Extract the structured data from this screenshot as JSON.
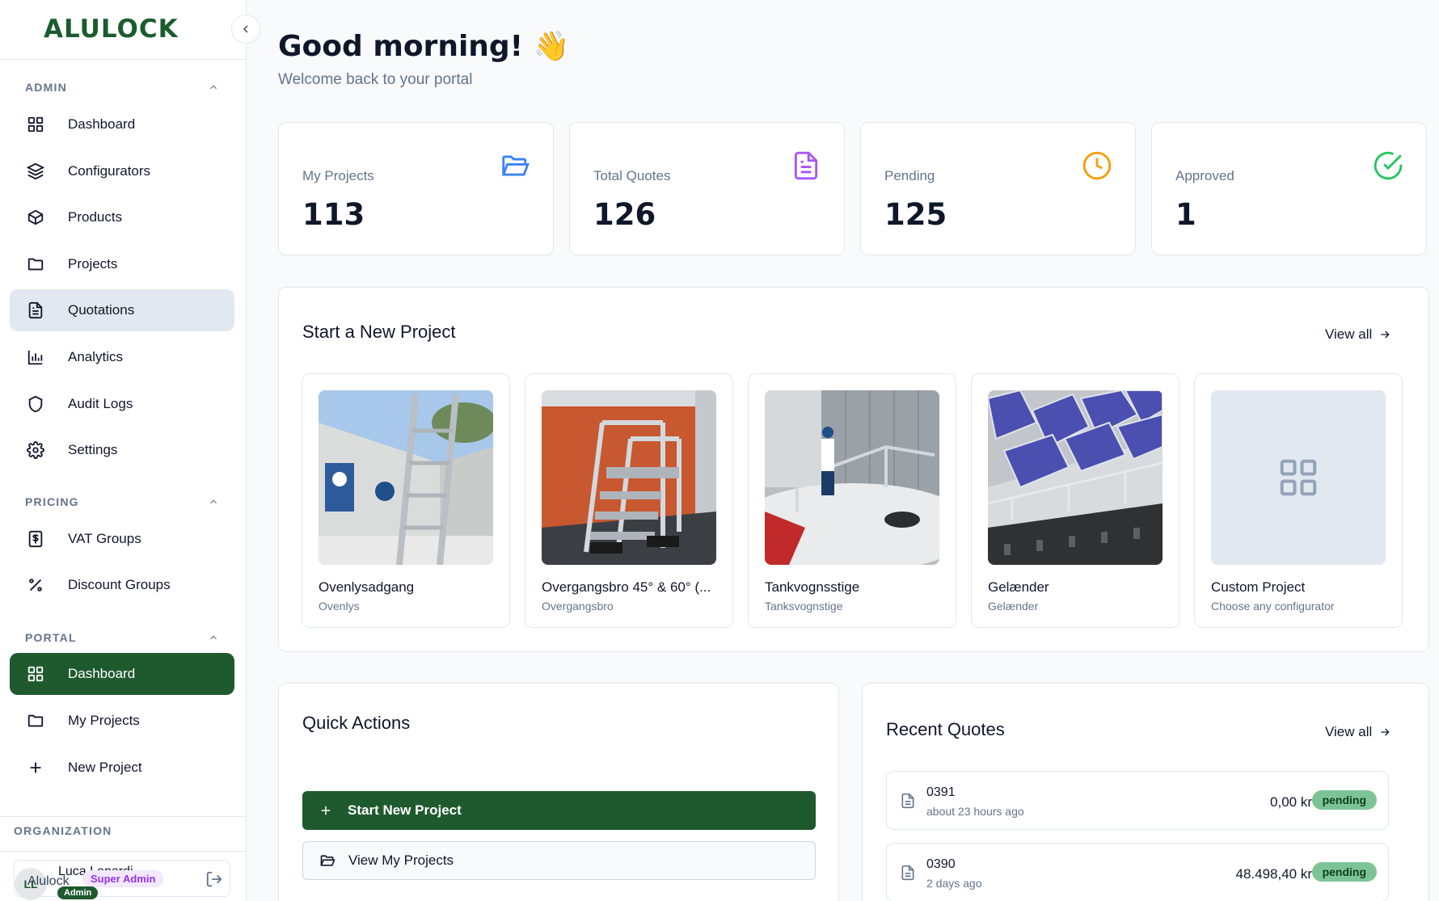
{
  "brand": {
    "logo_text": "ALULOCK"
  },
  "sidebar": {
    "sections": {
      "admin": "ADMIN",
      "pricing": "PRICING",
      "portal": "PORTAL",
      "organization": "ORGANIZATION"
    },
    "admin_items": [
      {
        "label": "Dashboard",
        "icon": "grid-icon"
      },
      {
        "label": "Configurators",
        "icon": "layers-icon"
      },
      {
        "label": "Products",
        "icon": "box-icon"
      },
      {
        "label": "Projects",
        "icon": "folder-icon"
      },
      {
        "label": "Quotations",
        "icon": "file-text-icon"
      },
      {
        "label": "Analytics",
        "icon": "bar-chart-icon"
      },
      {
        "label": "Audit Logs",
        "icon": "shield-icon"
      },
      {
        "label": "Settings",
        "icon": "gear-icon"
      }
    ],
    "pricing_items": [
      {
        "label": "VAT Groups",
        "icon": "dollar-receipt-icon"
      },
      {
        "label": "Discount Groups",
        "icon": "percent-icon"
      }
    ],
    "portal_items": [
      {
        "label": "Dashboard",
        "icon": "grid-icon"
      },
      {
        "label": "My Projects",
        "icon": "folder-icon"
      },
      {
        "label": "New Project",
        "icon": "plus-icon"
      }
    ],
    "user": {
      "avatar_initials": "LL",
      "name": "Luca Lonardi",
      "org": "Alulock",
      "role_badge": "Super Admin",
      "admin_badge": "Admin"
    }
  },
  "header": {
    "greeting": "Good morning! 👋",
    "subtitle": "Welcome back to your portal"
  },
  "stats": [
    {
      "label": "My Projects",
      "value": "113",
      "icon": "folder-open-icon",
      "color": "#3b82f6"
    },
    {
      "label": "Total Quotes",
      "value": "126",
      "icon": "file-text-icon",
      "color": "#a855f7"
    },
    {
      "label": "Pending",
      "value": "125",
      "icon": "clock-icon",
      "color": "#f59e0b"
    },
    {
      "label": "Approved",
      "value": "1",
      "icon": "check-circle-icon",
      "color": "#22c55e"
    }
  ],
  "new_project": {
    "title": "Start a New Project",
    "view_all": "View all",
    "items": [
      {
        "name": "Ovenlysadgang",
        "sub": "Ovenlys"
      },
      {
        "name": "Overgangsbro 45° & 60° (...",
        "sub": "Overgangsbro"
      },
      {
        "name": "Tankvognsstige",
        "sub": "Tanksvognstige"
      },
      {
        "name": "Gelænder",
        "sub": "Gelænder"
      },
      {
        "name": "Custom Project",
        "sub": "Choose any configurator"
      }
    ]
  },
  "quick_actions": {
    "title": "Quick Actions",
    "primary": "Start New Project",
    "secondary": "View My Projects"
  },
  "recent_quotes": {
    "title": "Recent Quotes",
    "view_all": "View all",
    "items": [
      {
        "number": "0391",
        "time": "about 23 hours ago",
        "amount": "0,00 kr",
        "status": "pending"
      },
      {
        "number": "0390",
        "time": "2 days ago",
        "amount": "48.498,40 kr",
        "status": "pending"
      }
    ]
  }
}
